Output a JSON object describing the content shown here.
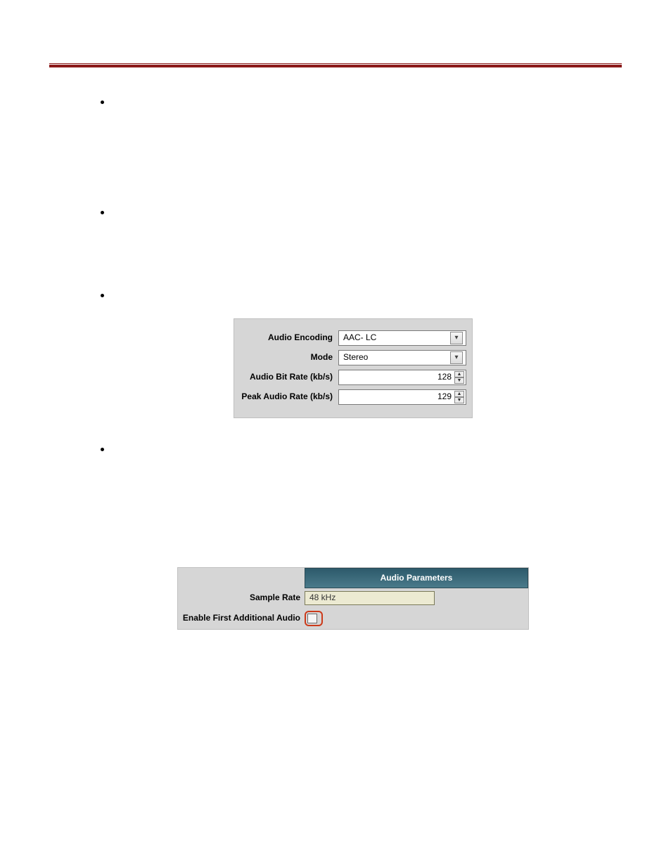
{
  "divider_color": "#8B1A1A",
  "bullets": {
    "items": [
      {
        "text": "​"
      },
      {
        "text": "​"
      },
      {
        "text": "​"
      },
      {
        "text": "​"
      }
    ]
  },
  "panel1": {
    "audio_encoding": {
      "label": "Audio Encoding",
      "value": "AAC- LC"
    },
    "mode": {
      "label": "Mode",
      "value": "Stereo"
    },
    "audio_bit_rate": {
      "label": "Audio Bit Rate (kb/s)",
      "value": "128"
    },
    "peak_audio_rate": {
      "label": "Peak Audio Rate (kb/s)",
      "value": "129"
    }
  },
  "panel2": {
    "title": "Audio Parameters",
    "sample_rate": {
      "label": "Sample Rate",
      "value": "48 kHz"
    },
    "enable_first_additional_audio": {
      "label": "Enable First Additional Audio",
      "checked": false
    }
  }
}
